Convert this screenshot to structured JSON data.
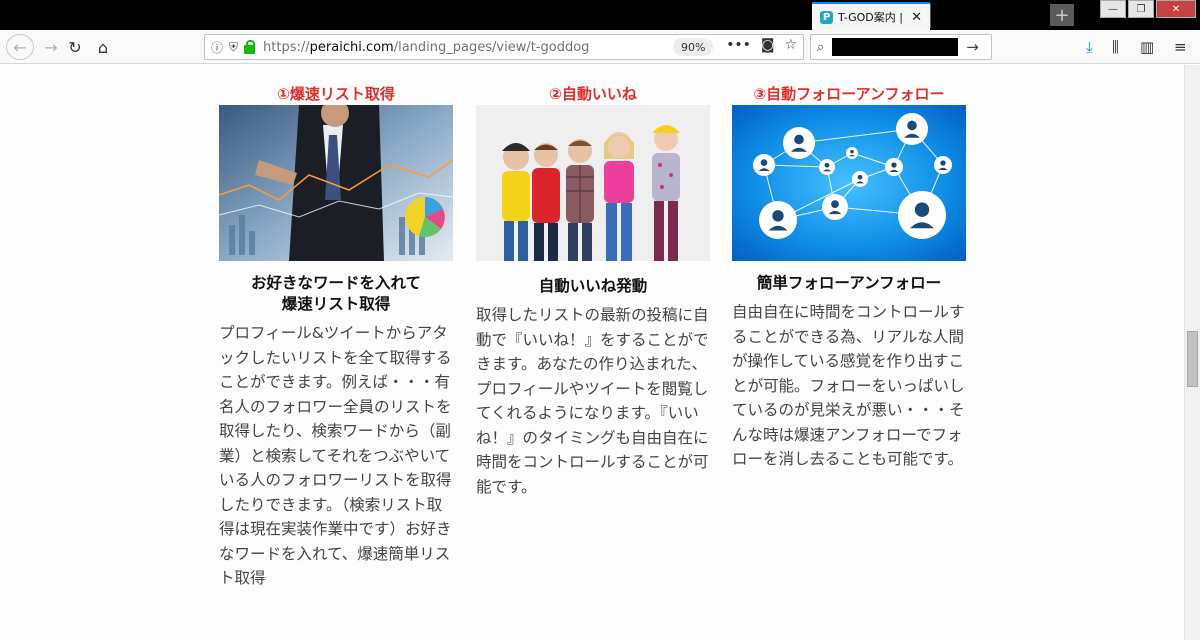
{
  "tab": {
    "favicon": "P",
    "title": "T-GOD案内 |",
    "close": "✕"
  },
  "window_controls": {
    "minimize": "—",
    "restore": "❐",
    "close": "✕"
  },
  "newtab": "+",
  "nav": {
    "back": "←",
    "forward": "→",
    "reload": "↻",
    "home": "⌂"
  },
  "urlbar": {
    "info": "ⓘ",
    "shield": "⛨",
    "scheme": "https://",
    "host": "peraichi.com",
    "path": "/landing_pages/view/t-goddog",
    "zoom": "90%",
    "page_actions": {
      "more": "•••",
      "pocket": "◙",
      "bookmark": "☆"
    }
  },
  "searchbar": {
    "icon": "⌕",
    "go": "→"
  },
  "toolbar_right": {
    "downloads": "⤓",
    "library": "⫼",
    "sidebar": "▥",
    "menu": "≡"
  },
  "columns": [
    {
      "heading": "①爆速リスト取得",
      "subtitle": "お好きなワードを入れて\n爆速リスト取得",
      "body": "プロフィール&ツイートからアタックしたいリストを全て取得することができます。例えば・・・有名人のフォロワー全員のリストを取得したり、検索ワードから（副業）と検索してそれをつぶやいている人のフォロワーリストを取得したりできます。（検索リスト取得は現在実装作業中です）お好きなワードを入れて、爆速簡単リスト取得"
    },
    {
      "heading": "②自動いいね",
      "subtitle": "自動いいね発動",
      "body": "取得したリストの最新の投稿に自動で『いいね！』をすることができます。あなたの作り込まれた、プロフィールやツイートを閲覧してくれるようになります。『いいね！』のタイミングも自由自在に時間をコントロールすることが可能です。"
    },
    {
      "heading": "③自動フォローアンフォロー",
      "subtitle": "簡単フォローアンフォロー",
      "body": "自由自在に時間をコントロールすることができる為、リアルな人間が操作している感覚を作り出すことが可能。フォローをいっぱいしているのが見栄えが悪い・・・そんな時は爆速アンフォローでフォローを消し去ることも可能です。"
    }
  ],
  "colors": {
    "heading_red": "#e0302d",
    "tab_accent": "#0a84ff",
    "lock_green": "#12bc00"
  }
}
